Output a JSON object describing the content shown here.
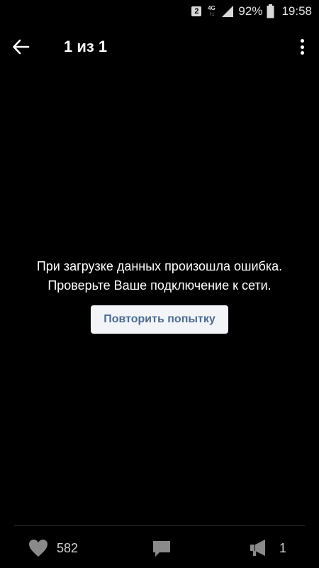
{
  "status_bar": {
    "sim_slot": "2",
    "network_type": "4G",
    "battery_percent": "92%",
    "time": "19:58"
  },
  "toolbar": {
    "title": "1 из 1",
    "back_icon": "arrow-left-icon",
    "menu_icon": "more-vertical-icon"
  },
  "error": {
    "line1": "При загрузке данных произошла ошибка.",
    "line2": "Проверьте Ваше подключение к сети.",
    "retry_label": "Повторить попытку"
  },
  "bottom_bar": {
    "like_count": "582",
    "share_count": "1",
    "like_icon": "heart-icon",
    "comment_icon": "comment-icon",
    "share_icon": "megaphone-icon"
  },
  "colors": {
    "background": "#000000",
    "retry_button_bg": "#f2f4f7",
    "retry_button_text": "#4c6c91",
    "bottom_icons": "#8a8a8a"
  }
}
